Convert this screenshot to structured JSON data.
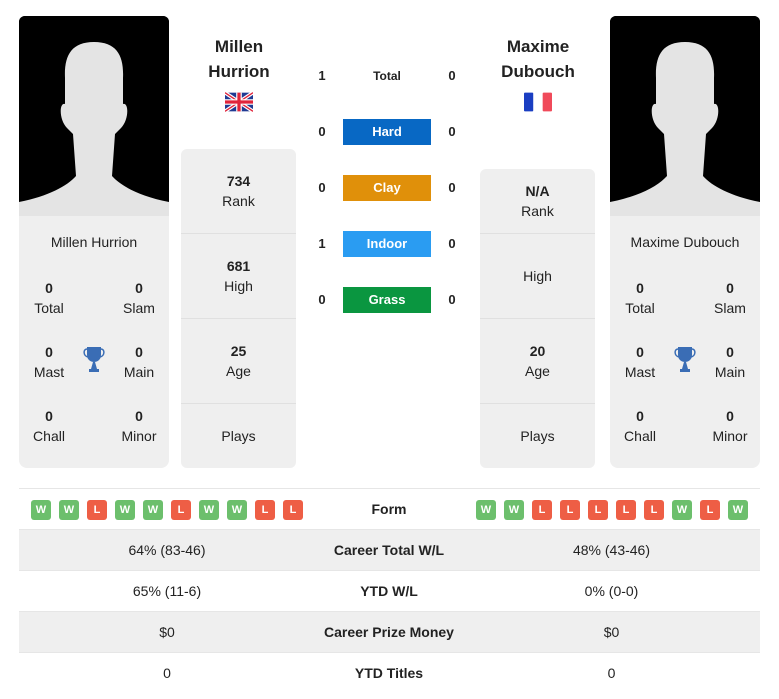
{
  "colors": {
    "hard": "#0868c4",
    "clay": "#e0900a",
    "indoor": "#2a9cf2",
    "grass": "#0a9640",
    "win": "#6cbf6c",
    "loss": "#ee5e45",
    "trophy": "#3a6db5"
  },
  "player1": {
    "name_line1": "Millen",
    "name_line2": "Hurrion",
    "full_name": "Millen Hurrion",
    "flag": "gb-flag",
    "titles": {
      "total": {
        "value": "0",
        "label": "Total"
      },
      "slam": {
        "value": "0",
        "label": "Slam"
      },
      "mast": {
        "value": "0",
        "label": "Mast"
      },
      "main": {
        "value": "0",
        "label": "Main"
      },
      "chall": {
        "value": "0",
        "label": "Chall"
      },
      "minor": {
        "value": "0",
        "label": "Minor"
      }
    },
    "rank": {
      "value": "734",
      "label": "Rank"
    },
    "high": {
      "value": "681",
      "label": "High"
    },
    "age": {
      "value": "25",
      "label": "Age"
    },
    "plays": {
      "value": "",
      "label": "Plays"
    }
  },
  "player2": {
    "name_line1": "Maxime",
    "name_line2": "Dubouch",
    "full_name": "Maxime Dubouch",
    "flag": "fr-flag",
    "titles": {
      "total": {
        "value": "0",
        "label": "Total"
      },
      "slam": {
        "value": "0",
        "label": "Slam"
      },
      "mast": {
        "value": "0",
        "label": "Mast"
      },
      "main": {
        "value": "0",
        "label": "Main"
      },
      "chall": {
        "value": "0",
        "label": "Chall"
      },
      "minor": {
        "value": "0",
        "label": "Minor"
      }
    },
    "rank": {
      "value": "N/A",
      "label": "Rank"
    },
    "high": {
      "value": "",
      "label": "High"
    },
    "age": {
      "value": "20",
      "label": "Age"
    },
    "plays": {
      "value": "",
      "label": "Plays"
    }
  },
  "h2h": [
    {
      "surface": "Total",
      "p1": "1",
      "p2": "0"
    },
    {
      "surface": "Hard",
      "p1": "0",
      "p2": "0"
    },
    {
      "surface": "Clay",
      "p1": "0",
      "p2": "0"
    },
    {
      "surface": "Indoor",
      "p1": "1",
      "p2": "0"
    },
    {
      "surface": "Grass",
      "p1": "0",
      "p2": "0"
    }
  ],
  "stats": {
    "form": {
      "label": "Form",
      "p1": [
        "W",
        "W",
        "L",
        "W",
        "W",
        "L",
        "W",
        "W",
        "L",
        "L"
      ],
      "p2": [
        "W",
        "W",
        "L",
        "L",
        "L",
        "L",
        "L",
        "W",
        "L",
        "W"
      ]
    },
    "rows": [
      {
        "label": "Career Total W/L",
        "p1": "64% (83-46)",
        "p2": "48% (43-46)"
      },
      {
        "label": "YTD W/L",
        "p1": "65% (11-6)",
        "p2": "0% (0-0)"
      },
      {
        "label": "Career Prize Money",
        "p1": "$0",
        "p2": "$0"
      },
      {
        "label": "YTD Titles",
        "p1": "0",
        "p2": "0"
      }
    ]
  }
}
